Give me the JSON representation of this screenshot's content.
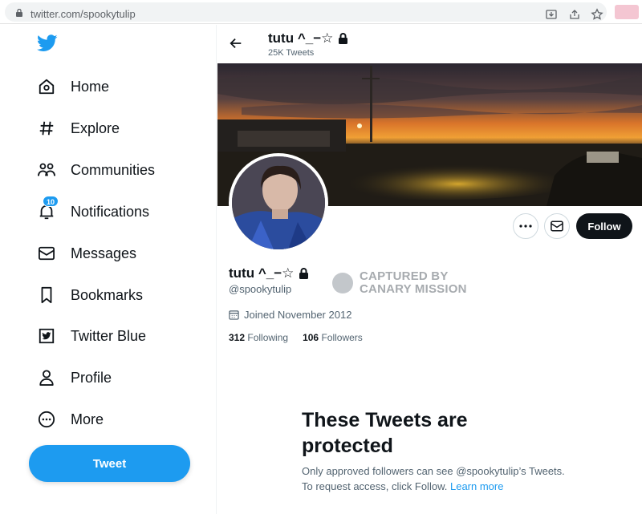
{
  "browser": {
    "url": "twitter.com/spookytulip"
  },
  "sidebar": {
    "items": [
      {
        "label": "Home",
        "icon": "home-icon"
      },
      {
        "label": "Explore",
        "icon": "hashtag-icon"
      },
      {
        "label": "Communities",
        "icon": "communities-icon"
      },
      {
        "label": "Notifications",
        "icon": "bell-icon",
        "badge": "10"
      },
      {
        "label": "Messages",
        "icon": "envelope-icon"
      },
      {
        "label": "Bookmarks",
        "icon": "bookmark-icon"
      },
      {
        "label": "Twitter Blue",
        "icon": "twitter-blue-icon"
      },
      {
        "label": "Profile",
        "icon": "person-icon"
      },
      {
        "label": "More",
        "icon": "more-circle-icon"
      }
    ],
    "tweet_button": "Tweet"
  },
  "profile": {
    "display_name": "tutu ^_−☆",
    "tweet_count": "25K Tweets",
    "handle": "@spookytulip",
    "joined": "Joined November 2012",
    "following_count": "312",
    "following_label": "Following",
    "followers_count": "106",
    "followers_label": "Followers",
    "follow_button": "Follow"
  },
  "stamp": {
    "line1": "CAPTURED BY",
    "line2": "CANARY MISSION"
  },
  "protected": {
    "title": "These Tweets are protected",
    "body": "Only approved followers can see @spookytulip’s Tweets. To request access, click Follow.",
    "link": "Learn more"
  },
  "colors": {
    "accent": "#1d9bf0",
    "text": "#0f1419",
    "muted": "#536471"
  }
}
